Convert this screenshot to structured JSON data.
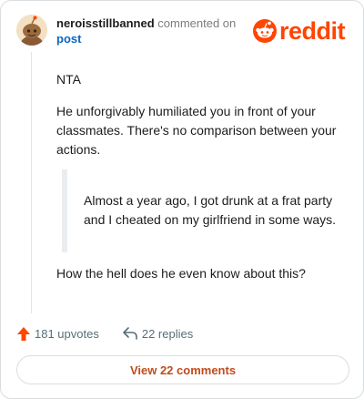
{
  "header": {
    "author": "neroisstillbanned",
    "action_text": "commented on",
    "post_link": "post",
    "brand_name": "reddit",
    "brand_color": "#ff4500",
    "avatar_icon": "snoo-avatar-icon"
  },
  "comment": {
    "paragraphs": [
      "NTA",
      "He unforgivably humiliated you in front of your classmates. There's no comparison between your actions."
    ],
    "quote": "Almost a year ago, I got drunk at a frat party and I cheated on my girlfriend in some ways.",
    "closing": "How the hell does he even know about this?"
  },
  "footer": {
    "upvotes": "181 upvotes",
    "replies": "22 replies",
    "upvote_icon": "upvote-arrow-icon",
    "reply_icon": "reply-arrow-icon",
    "view_comments_label": "View 22 comments",
    "upvote_color": "#ff4500"
  }
}
